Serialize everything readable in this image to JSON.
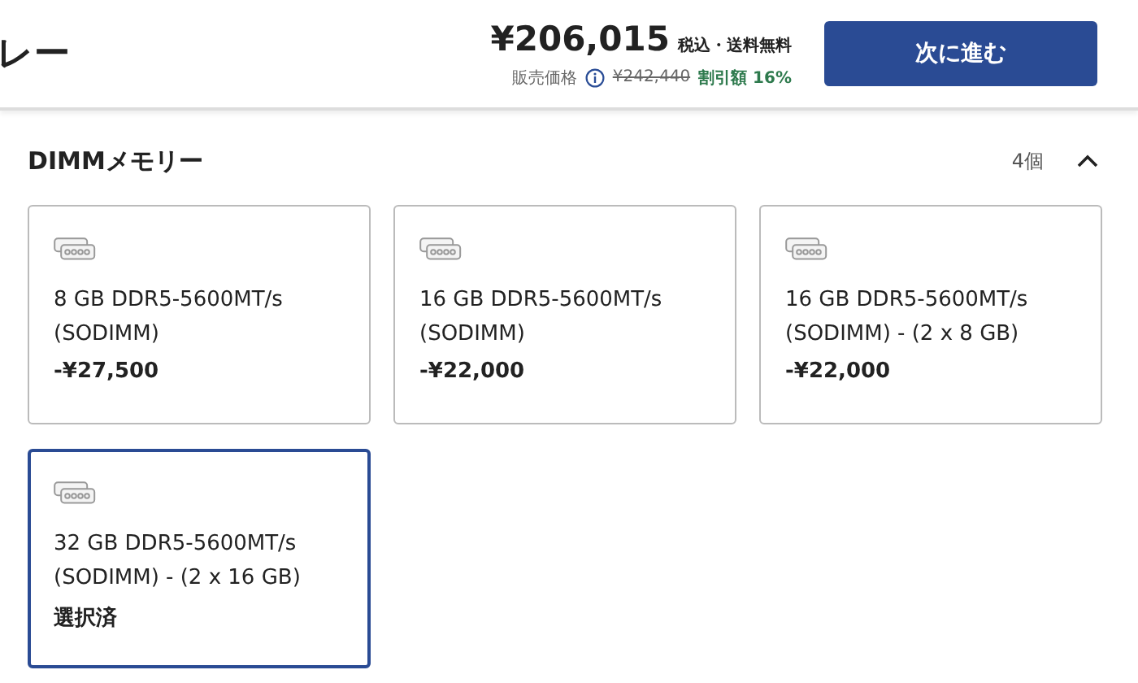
{
  "header": {
    "title": "レー",
    "price": "¥206,015",
    "price_note": "税込・送料無料",
    "list_label": "販売価格",
    "list_price": "¥242,440",
    "discount": "割引額 16%",
    "next_button": "次に進む"
  },
  "section": {
    "title": "DIMMメモリー",
    "count": "4個",
    "expanded": true
  },
  "options": [
    {
      "name": "8 GB DDR5-5600MT/s (SODIMM)",
      "detail": "-¥27,500",
      "selected": false
    },
    {
      "name": "16 GB DDR5-5600MT/s (SODIMM)",
      "detail": "-¥22,000",
      "selected": false
    },
    {
      "name": "16 GB DDR5-5600MT/s (SODIMM) - (2 x 8 GB)",
      "detail": "-¥22,000",
      "selected": false
    },
    {
      "name": "32 GB DDR5-5600MT/s (SODIMM) - (2 x 16 GB)",
      "detail": "選択済",
      "selected": true
    }
  ]
}
